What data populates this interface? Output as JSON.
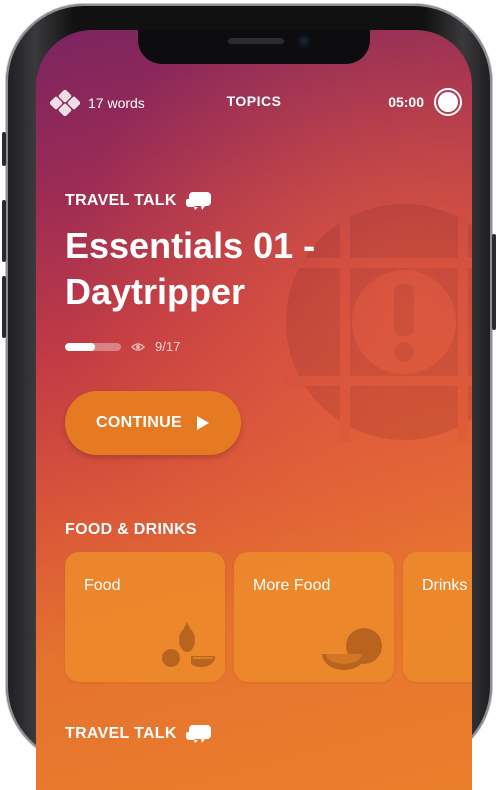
{
  "status": {
    "word_count": "17 words",
    "nav_title": "TOPICS",
    "timer": "05:00"
  },
  "lesson": {
    "category": "TRAVEL TALK",
    "title": "Essentials 01 - Daytripper",
    "progress_text": "9/17",
    "progress_fraction": 0.5294,
    "continue_label": "CONTINUE"
  },
  "sections": [
    {
      "label": "FOOD & DRINKS",
      "cards": [
        {
          "label": "Food",
          "icon": "fruit-icon"
        },
        {
          "label": "More Food",
          "icon": "coconut-icon"
        },
        {
          "label": "Drinks",
          "icon": ""
        }
      ]
    },
    {
      "label": "TRAVEL TALK"
    }
  ],
  "colors": {
    "accent": "#e57a22",
    "gradient_top": "#7b2461",
    "gradient_bottom": "#ea7f2b"
  }
}
